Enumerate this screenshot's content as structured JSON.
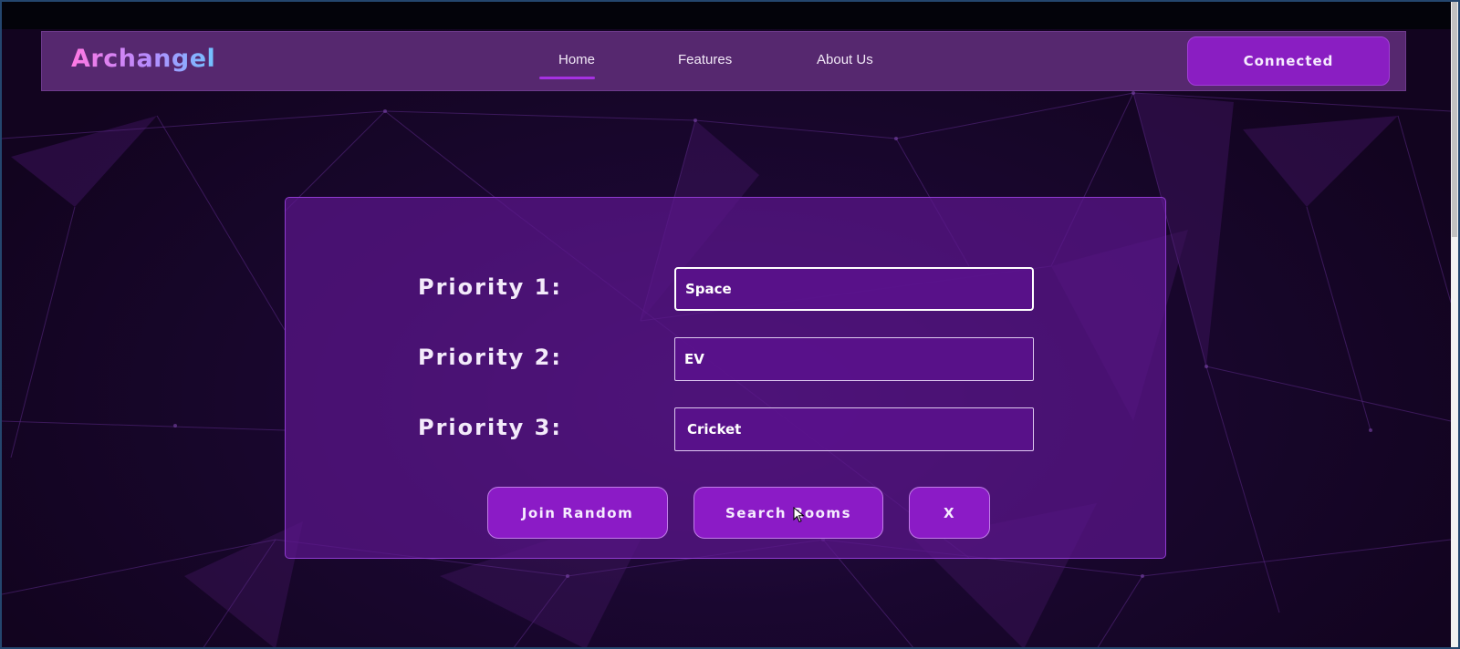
{
  "navbar": {
    "brand": "Archangel",
    "links": [
      {
        "label": "Home",
        "active": true
      },
      {
        "label": "Features",
        "active": false
      },
      {
        "label": "About Us",
        "active": false
      }
    ],
    "status_button": "Connected"
  },
  "form": {
    "priorities": [
      {
        "label": "Priority 1:",
        "value": "Space"
      },
      {
        "label": "Priority 2:",
        "value": "EV"
      },
      {
        "label": "Priority 3:",
        "value": "Cricket"
      }
    ],
    "buttons": {
      "join_random": "Join Random",
      "search_rooms": "Search Rooms",
      "close": "X"
    }
  },
  "colors": {
    "accent": "#8b1bc6",
    "navbar": "#56286f",
    "background": "#1a0730",
    "brand_gradient": [
      "#ff78e3",
      "#b48cff",
      "#71c3ff"
    ]
  },
  "icons": {
    "cursor": "mouse-pointer-icon"
  }
}
